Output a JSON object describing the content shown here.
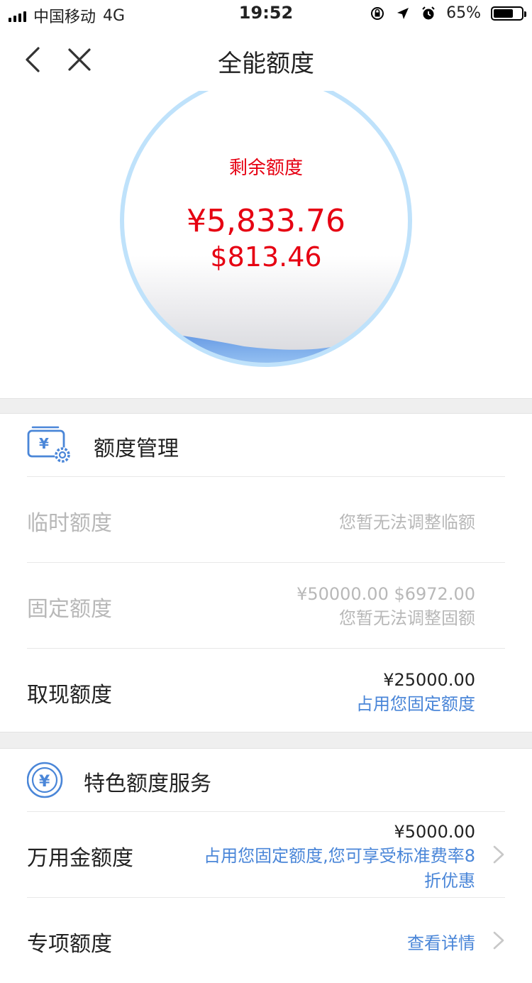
{
  "status_bar": {
    "carrier": "中国移动",
    "network": "4G",
    "time": "19:52",
    "battery": "65%"
  },
  "nav": {
    "title": "全能额度"
  },
  "hero": {
    "label": "剩余额度",
    "rmb_amount": "¥5,833.76",
    "usd_amount": "$813.46"
  },
  "management": {
    "title": "额度管理",
    "items": [
      {
        "name": "临时额度",
        "line1": "您暂无法调整临额",
        "line2": ""
      },
      {
        "name": "固定额度",
        "line1": "¥50000.00 $6972.00",
        "line2": "您暂无法调整固额"
      },
      {
        "name": "取现额度",
        "line1": "¥25000.00",
        "line2": "占用您固定额度"
      }
    ]
  },
  "special": {
    "title": "特色额度服务",
    "items": [
      {
        "name": "万用金额度",
        "line1": "¥5000.00",
        "line2a": "占用您固定额度,您可享受标准费率8",
        "line2b": "折优惠"
      },
      {
        "name": "专项额度",
        "line1": "查看详情"
      }
    ]
  },
  "colors": {
    "accent_red": "#e60012",
    "link_blue": "#4a86d8",
    "disabled_gray": "#b8b8b8"
  }
}
